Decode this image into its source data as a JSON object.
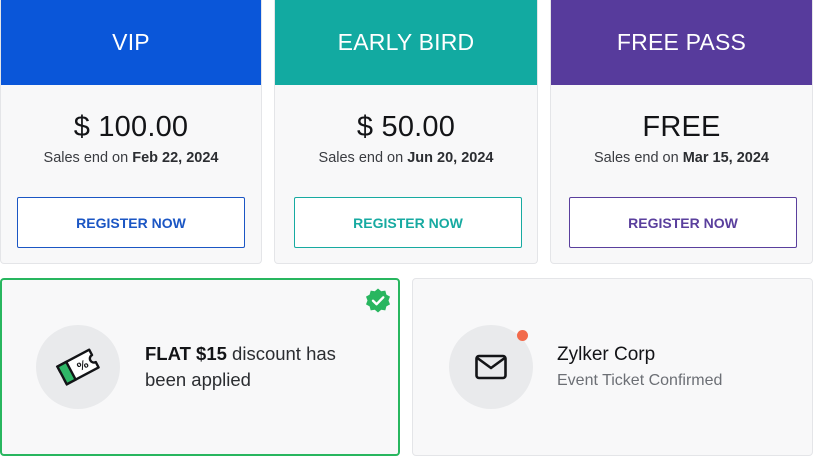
{
  "tickets": [
    {
      "name": "VIP",
      "price": "$ 100.00",
      "sales_end_prefix": "Sales end on",
      "sales_end_date": "Feb 22, 2024",
      "button": "REGISTER NOW",
      "color": "#0a56d9"
    },
    {
      "name": "EARLY BIRD",
      "price": "$ 50.00",
      "sales_end_prefix": "Sales end on",
      "sales_end_date": "Jun 20, 2024",
      "button": "REGISTER NOW",
      "color": "#12aaa1"
    },
    {
      "name": "FREE PASS",
      "price": "FREE",
      "sales_end_prefix": "Sales end on",
      "sales_end_date": "Mar 15, 2024",
      "button": "REGISTER NOW",
      "color": "#573b9c"
    }
  ],
  "discount": {
    "highlight": "FLAT $15",
    "message": "discount has been applied",
    "icon": "discount-ticket-icon",
    "badge_icon": "verified-check-icon",
    "accent_color": "#28b65f"
  },
  "notification": {
    "company": "Zylker Corp",
    "status": "Event Ticket Confirmed",
    "icon": "envelope-icon",
    "dot_color": "#f26a4b"
  }
}
